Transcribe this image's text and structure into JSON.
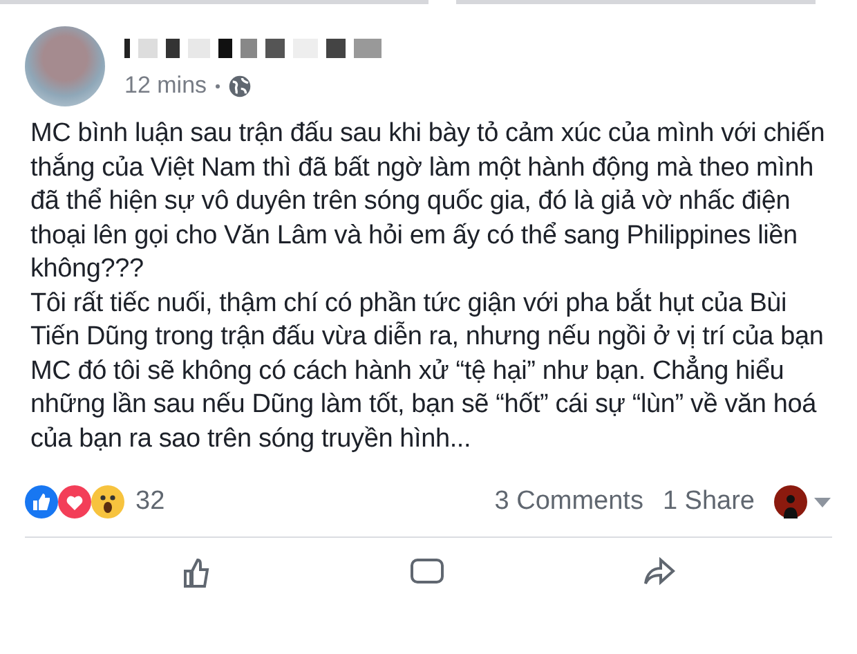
{
  "post": {
    "time": "12 mins",
    "paragraphs": [
      "MC bình luận sau trận đấu sau khi bày tỏ cảm xúc của mình với chiến thắng của Việt Nam thì đã bất ngờ làm một hành động mà theo mình đã thể hiện sự vô duyên trên sóng quốc gia, đó là giả vờ nhấc điện thoại lên gọi cho Văn Lâm và hỏi em ấy có thể sang Philippines liền không???",
      "Tôi rất tiếc nuối, thậm chí có phần tức giận với pha bắt hụt của Bùi Tiến Dũng trong trận đấu vừa diễn ra, nhưng nếu ngồi ở vị trí của bạn MC đó tôi sẽ không có cách hành xử “tệ hại” như bạn. Chẳng hiểu những lần sau nếu Dũng làm tốt, bạn sẽ “hốt” cái sự “lùn” về văn hoá của bạn ra sao trên sóng truyền hình..."
    ]
  },
  "stats": {
    "reaction_count": "32",
    "comments": "3 Comments",
    "shares": "1 Share"
  }
}
